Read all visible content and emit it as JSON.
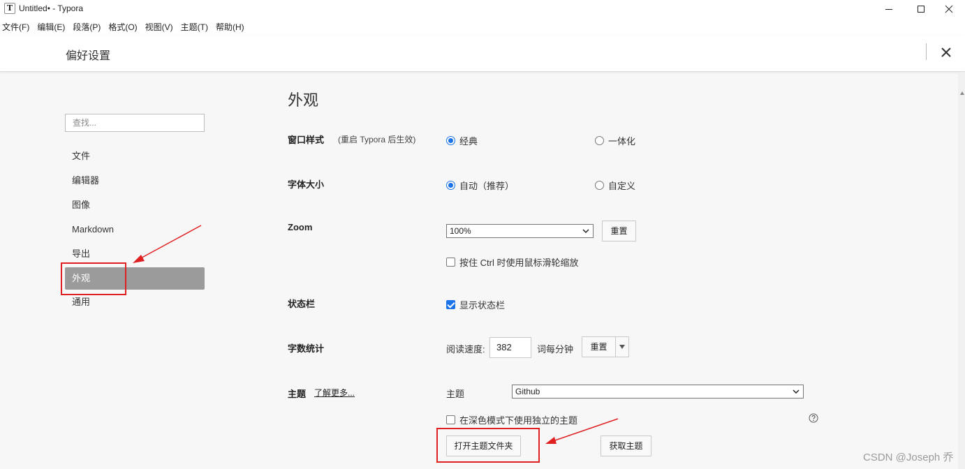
{
  "window": {
    "title": "Untitled• - Typora",
    "app_icon": "T"
  },
  "menu": [
    "文件(F)",
    "编辑(E)",
    "段落(P)",
    "格式(O)",
    "视图(V)",
    "主题(T)",
    "帮助(H)"
  ],
  "prefs": {
    "title": "偏好设置"
  },
  "sidebar": {
    "search_placeholder": "查找...",
    "items": [
      "文件",
      "编辑器",
      "图像",
      "Markdown",
      "导出",
      "外观",
      "通用"
    ],
    "active_item": "外观"
  },
  "section": {
    "title": "外观",
    "window_style": {
      "label": "窗口样式",
      "note": "(重启 Typora 后生效)",
      "options": [
        "经典",
        "一体化"
      ],
      "selected": "经典"
    },
    "font_size": {
      "label": "字体大小",
      "options": [
        "自动（推荐）",
        "自定义"
      ],
      "selected": "自动（推荐）"
    },
    "zoom": {
      "label": "Zoom",
      "value": "100%",
      "reset_label": "重置",
      "ctrl_wheel_label": "按住 Ctrl 时使用鼠标滑轮缩放",
      "ctrl_wheel_checked": false
    },
    "status_bar": {
      "label": "状态栏",
      "show_label": "显示状态栏",
      "checked": true
    },
    "word_count": {
      "label": "字数统计",
      "speed_label": "阅读速度:",
      "speed_value": "382",
      "unit_label": "词每分钟",
      "reset_label": "重置"
    },
    "theme": {
      "label": "主题",
      "learn_more": "了解更多...",
      "select_label": "主题",
      "value": "Github",
      "dark_mode_label": "在深色模式下使用独立的主题",
      "dark_mode_checked": false,
      "open_folder_label": "打开主题文件夹",
      "get_themes_label": "获取主题"
    }
  },
  "watermark": "CSDN @Joseph 乔",
  "colors": {
    "accent": "#1a73e8",
    "annotation": "#e02020",
    "active_sidebar": "#9b9b9b"
  }
}
